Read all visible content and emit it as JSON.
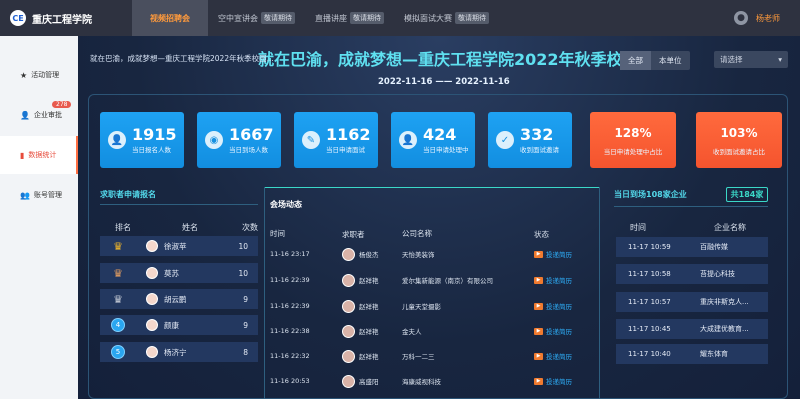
{
  "brand": {
    "name": "重庆工程学院",
    "logo_text": "CE"
  },
  "nav": {
    "tabs": [
      {
        "label": "视频招聘会",
        "tag": ""
      },
      {
        "label": "空中宣讲会",
        "tag": "敬请期待"
      },
      {
        "label": "直播讲座",
        "tag": "敬请期待"
      },
      {
        "label": "模拟面试大赛",
        "tag": "敬请期待"
      }
    ],
    "user_name": "杨老师"
  },
  "sidebar": {
    "items": [
      {
        "label": "活动管理",
        "icon": "star-icon"
      },
      {
        "label": "企业审批",
        "icon": "user-icon",
        "badge": "278"
      },
      {
        "label": "数据统计",
        "icon": "chart-icon"
      },
      {
        "label": "账号管理",
        "icon": "account-icon"
      }
    ]
  },
  "header": {
    "marquee": "就在巴渝，成就梦想—重庆工程学院2022年秋季校园...",
    "title": "就在巴渝，成就梦想—重庆工程学院2022年秋季校园双选会",
    "dates": "2022-11-16 —— 2022-11-16",
    "filter_all": "全部",
    "filter_unit": "本单位",
    "select_placeholder": "请选择"
  },
  "stats": [
    {
      "value": "1915",
      "label": "当日报名人数",
      "icon": "person-icon"
    },
    {
      "value": "1667",
      "label": "当日到场人数",
      "icon": "location-icon"
    },
    {
      "value": "1162",
      "label": "当日申请面试",
      "icon": "edit-icon"
    },
    {
      "value": "424",
      "label": "当日申请处理中",
      "icon": "person-icon"
    },
    {
      "value": "332",
      "label": "收到面试邀请",
      "icon": "check-icon"
    },
    {
      "value": "128%",
      "label": "当日申请处理中占比"
    },
    {
      "value": "103%",
      "label": "收到面试邀请占比"
    }
  ],
  "ranking": {
    "title": "求职者申请报名",
    "columns": [
      "排名",
      "姓名",
      "次数"
    ],
    "rows": [
      {
        "rank": "1",
        "name": "徐淑苹",
        "count": "10"
      },
      {
        "rank": "2",
        "name": "莫苏",
        "count": "10"
      },
      {
        "rank": "3",
        "name": "胡云鹏",
        "count": "9"
      },
      {
        "rank": "4",
        "name": "颜康",
        "count": "9"
      },
      {
        "rank": "5",
        "name": "杨济宁",
        "count": "8"
      }
    ]
  },
  "feed": {
    "title": "会场动态",
    "columns": [
      "时间",
      "求职者",
      "公司名称",
      "状态"
    ],
    "rows": [
      {
        "time": "11-16 23:17",
        "seeker": "杨俊杰",
        "company": "天怡美装饰",
        "status": "投递简历"
      },
      {
        "time": "11-16 22:39",
        "seeker": "赵祥艳",
        "company": "爱尔集新能源（南京）有限公司",
        "status": "投递简历"
      },
      {
        "time": "11-16 22:39",
        "seeker": "赵祥艳",
        "company": "儿童天堂摄影",
        "status": "投递简历"
      },
      {
        "time": "11-16 22:38",
        "seeker": "赵祥艳",
        "company": "金夫人",
        "status": "投递简历"
      },
      {
        "time": "11-16 22:32",
        "seeker": "赵祥艳",
        "company": "万科一二三",
        "status": "投递简历"
      },
      {
        "time": "11-16 20:53",
        "seeker": "高盛阳",
        "company": "海康威视科技",
        "status": "投递简历"
      }
    ]
  },
  "companies": {
    "title": "当日到场108家企业",
    "total": "共184家",
    "columns": [
      "时间",
      "企业名称"
    ],
    "rows": [
      {
        "time": "11-17 10:59",
        "name": "百融传媒"
      },
      {
        "time": "11-17 10:58",
        "name": "苔提心科技"
      },
      {
        "time": "11-17 10:57",
        "name": "重庆非斯克人..."
      },
      {
        "time": "11-17 10:45",
        "name": "大成建优教育..."
      },
      {
        "time": "11-17 10:40",
        "name": "耀东体育"
      }
    ]
  }
}
